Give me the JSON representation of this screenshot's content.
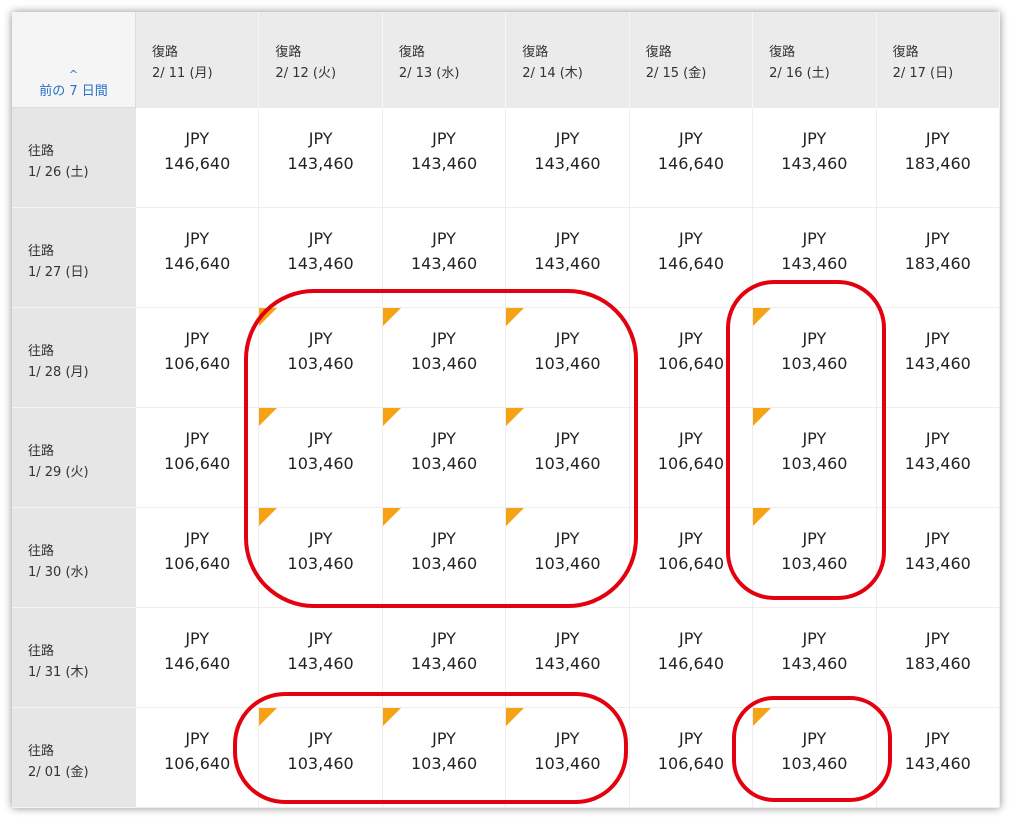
{
  "header": {
    "prev_link": {
      "caret": "^",
      "label": "前の 7 日間"
    },
    "return_label": "復路",
    "columns": [
      "2/ 11 (月)",
      "2/ 12 (火)",
      "2/ 13 (水)",
      "2/ 14 (木)",
      "2/ 15 (金)",
      "2/ 16 (土)",
      "2/ 17 (日)"
    ]
  },
  "outbound_label": "往路",
  "currency": "JPY",
  "rows": [
    {
      "date": "1/ 26 (土)",
      "prices": [
        "146,640",
        "143,460",
        "143,460",
        "143,460",
        "146,640",
        "143,460",
        "183,460"
      ],
      "flags": [
        0,
        0,
        0,
        0,
        0,
        0,
        0
      ]
    },
    {
      "date": "1/ 27 (日)",
      "prices": [
        "146,640",
        "143,460",
        "143,460",
        "143,460",
        "146,640",
        "143,460",
        "183,460"
      ],
      "flags": [
        0,
        0,
        0,
        0,
        0,
        0,
        0
      ]
    },
    {
      "date": "1/ 28 (月)",
      "prices": [
        "106,640",
        "103,460",
        "103,460",
        "103,460",
        "106,640",
        "103,460",
        "143,460"
      ],
      "flags": [
        0,
        1,
        1,
        1,
        0,
        1,
        0
      ]
    },
    {
      "date": "1/ 29 (火)",
      "prices": [
        "106,640",
        "103,460",
        "103,460",
        "103,460",
        "106,640",
        "103,460",
        "143,460"
      ],
      "flags": [
        0,
        1,
        1,
        1,
        0,
        1,
        0
      ]
    },
    {
      "date": "1/ 30 (水)",
      "prices": [
        "106,640",
        "103,460",
        "103,460",
        "103,460",
        "106,640",
        "103,460",
        "143,460"
      ],
      "flags": [
        0,
        1,
        1,
        1,
        0,
        1,
        0
      ]
    },
    {
      "date": "1/ 31 (木)",
      "prices": [
        "146,640",
        "143,460",
        "143,460",
        "143,460",
        "146,640",
        "143,460",
        "183,460"
      ],
      "flags": [
        0,
        0,
        0,
        0,
        0,
        0,
        0
      ]
    },
    {
      "date": "2/ 01 (金)",
      "prices": [
        "106,640",
        "103,460",
        "103,460",
        "103,460",
        "106,640",
        "103,460",
        "143,460"
      ],
      "flags": [
        0,
        1,
        1,
        1,
        0,
        1,
        0
      ]
    }
  ],
  "colors": {
    "flag": "#f5a214",
    "highlight": "#e3000f",
    "link": "#2a6fc9"
  }
}
